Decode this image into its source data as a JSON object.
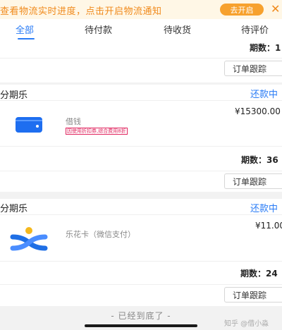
{
  "notice": {
    "text": "查看物流实时进度，点击开启物流通知",
    "button": "去开启",
    "close": "✕"
  },
  "tabs": [
    {
      "label": "全部",
      "active": true
    },
    {
      "label": "待付款"
    },
    {
      "label": "待收货"
    },
    {
      "label": "待评价"
    }
  ],
  "order_top": {
    "count_label": "期数：1",
    "track_button": "订单跟踪"
  },
  "orders": [
    {
      "merchant": "分期乐",
      "status": "还款中",
      "item_name": "借钱",
      "promo": "因使用折扣券,综合费用8折",
      "price": "¥15300.00",
      "count_label": "期数：36",
      "track_button": "订单跟踪",
      "icon": "wallet-icon"
    },
    {
      "merchant": "分期乐",
      "status": "还款中",
      "item_name": "乐花卡（微信支付）",
      "price": "¥11.00",
      "count_label": "期数：24",
      "track_button": "订单跟踪",
      "icon": "lehua-card-icon"
    }
  ],
  "footer": {
    "end_text": "- 已经到底了 -",
    "watermark": "知乎 @借小淼"
  },
  "colors": {
    "accent": "#2a7cf6",
    "notice_bg": "#fff7e6",
    "notice_text": "#f08a1c",
    "promo": "#e0245e"
  }
}
